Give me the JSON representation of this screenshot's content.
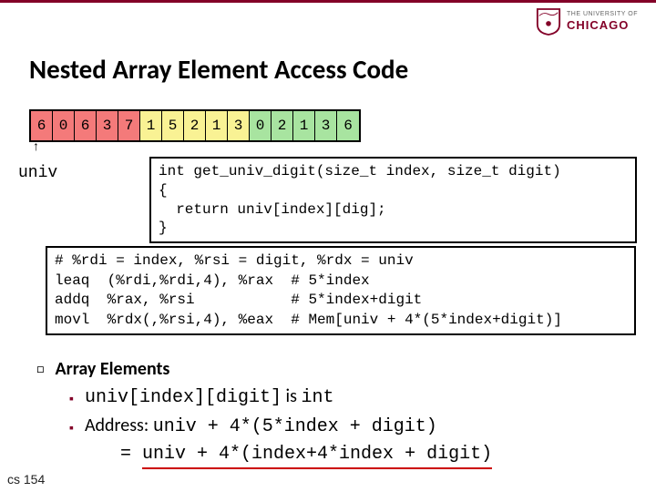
{
  "header": {
    "logo_the": "THE UNIVERSITY OF",
    "logo_name": "CHICAGO"
  },
  "title": "Nested Array Element Access Code",
  "array": {
    "cells": [
      "6",
      "0",
      "6",
      "3",
      "7",
      "1",
      "5",
      "2",
      "1",
      "3",
      "0",
      "2",
      "1",
      "3",
      "6"
    ],
    "colors": [
      "red",
      "red",
      "red",
      "red",
      "red",
      "yellow",
      "yellow",
      "yellow",
      "yellow",
      "yellow",
      "green",
      "green",
      "green",
      "green",
      "green"
    ]
  },
  "univ_label": "univ",
  "code_c": "int get_univ_digit(size_t index, size_t digit)\n{\n  return univ[index][dig];\n}",
  "code_asm": "# %rdi = index, %rsi = digit, %rdx = univ\nleaq  (%rdi,%rdi,4), %rax  # 5*index\naddq  %rax, %rsi           # 5*index+digit\nmovl  %rdx(,%rsi,4), %eax  # Mem[univ + 4*(5*index+digit)]",
  "bullets": {
    "heading": "Array Elements",
    "sub1_a": "univ[index][digit]",
    "sub1_b": " is ",
    "sub1_c": "int",
    "sub2_a": "Address: ",
    "sub2_b": "univ + 4*(5*index + digit)",
    "sub3_a": "= ",
    "sub3_b": "univ + 4*(index+4*index + digit)"
  },
  "footer": "cs 154"
}
